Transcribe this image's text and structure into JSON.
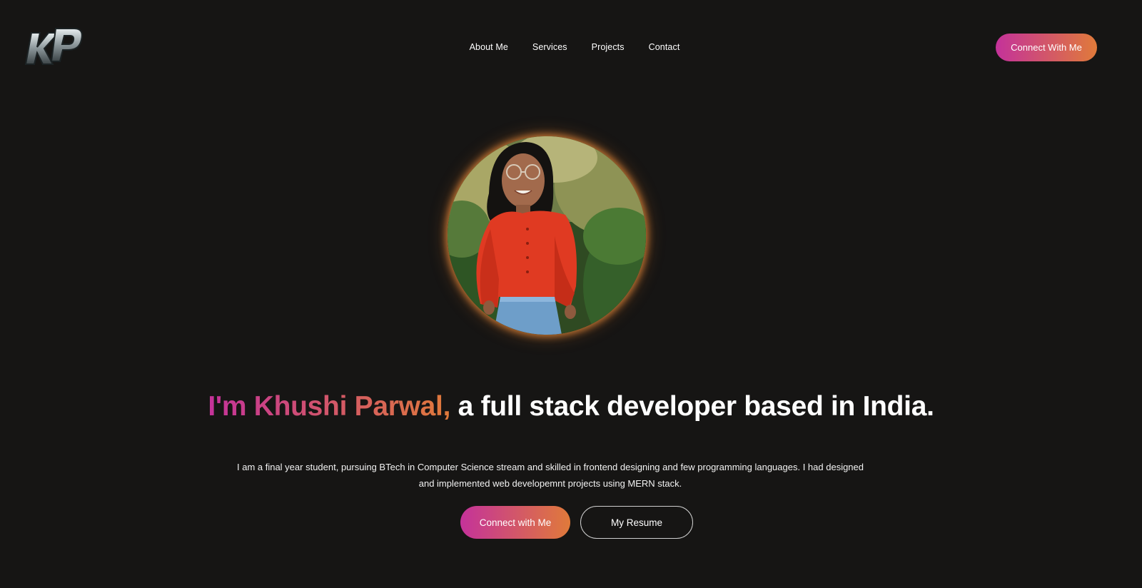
{
  "header": {
    "logo_text": "KP",
    "nav": [
      {
        "label": "About Me"
      },
      {
        "label": "Services"
      },
      {
        "label": "Projects"
      },
      {
        "label": "Contact"
      }
    ],
    "cta_label": "Connect With Me"
  },
  "hero": {
    "photo_alt": "Portrait of Khushi Parwal",
    "headline_highlight": "I'm Khushi Parwal,",
    "headline_rest": " a full stack developer based in India.",
    "bio": "I am a final year student, pursuing BTech in Computer Science stream and skilled in frontend designing and few programming languages. I had designed and implemented web developemnt projects using MERN stack.",
    "primary_button": "Connect with Me",
    "secondary_button": "My Resume"
  },
  "colors": {
    "background": "#161514",
    "gradient_start": "#c4329a",
    "gradient_end": "#e07a3a",
    "text": "#ffffff"
  }
}
